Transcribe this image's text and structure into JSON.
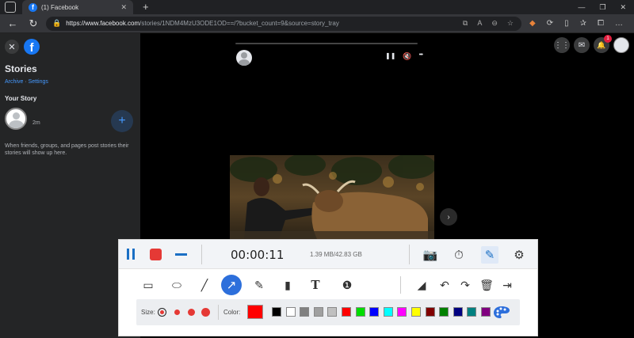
{
  "browser": {
    "tab_title": "(1) Facebook",
    "tab_logo": "f",
    "url_host": "https://www.facebook.com",
    "url_path": "/stories/1NDM4MzU3ODE1OD==/?bucket_count=9&source=story_tray"
  },
  "sidebar": {
    "logo": "f",
    "title": "Stories",
    "archive_link": "Archive",
    "link_separator": "·",
    "settings_link": "Settings",
    "your_story_label": "Your Story",
    "story_time": "2m",
    "empty_message": "When friends, groups, and pages post stories their stories will show up here."
  },
  "top_right": {
    "notification_count": "1"
  },
  "recorder": {
    "timer": "00:00:11",
    "file_size": "1.39 MB/42.83 GB",
    "size_label": "Size:",
    "color_label": "Color:",
    "selected_color": "#ff0000",
    "palette_colors": [
      "#000000",
      "#ffffff",
      "#808080",
      "#a0a0a0",
      "#c0c0c0",
      "#ff0000",
      "#00dd00",
      "#0000ff",
      "#00ffff",
      "#ff00ff",
      "#ffff00",
      "#800000",
      "#008000",
      "#000080",
      "#008080",
      "#800080"
    ]
  },
  "icons": {
    "tab_close": "✕",
    "new_tab": "+",
    "back": "←",
    "reload": "↻",
    "lock": "🔒",
    "close": "✕",
    "add_story": "+",
    "next": "›",
    "story_pause": "❚❚",
    "story_mute": "🔇",
    "story_more": "•••",
    "menu_grid": "⋮⋮",
    "messenger": "✉",
    "notifications": "🔔",
    "camera": "📷",
    "schedule": "⏱",
    "edit": "✎",
    "settings": "⚙",
    "rectangle": "▭",
    "ellipse": "⬭",
    "line": "╱",
    "arrow": "↗",
    "pen": "✎",
    "highlighter": "▮",
    "text": "T",
    "step": "❶",
    "eraser": "◢",
    "undo": "↶",
    "redo": "↷",
    "delete": "🗑",
    "exit": "⇥"
  }
}
